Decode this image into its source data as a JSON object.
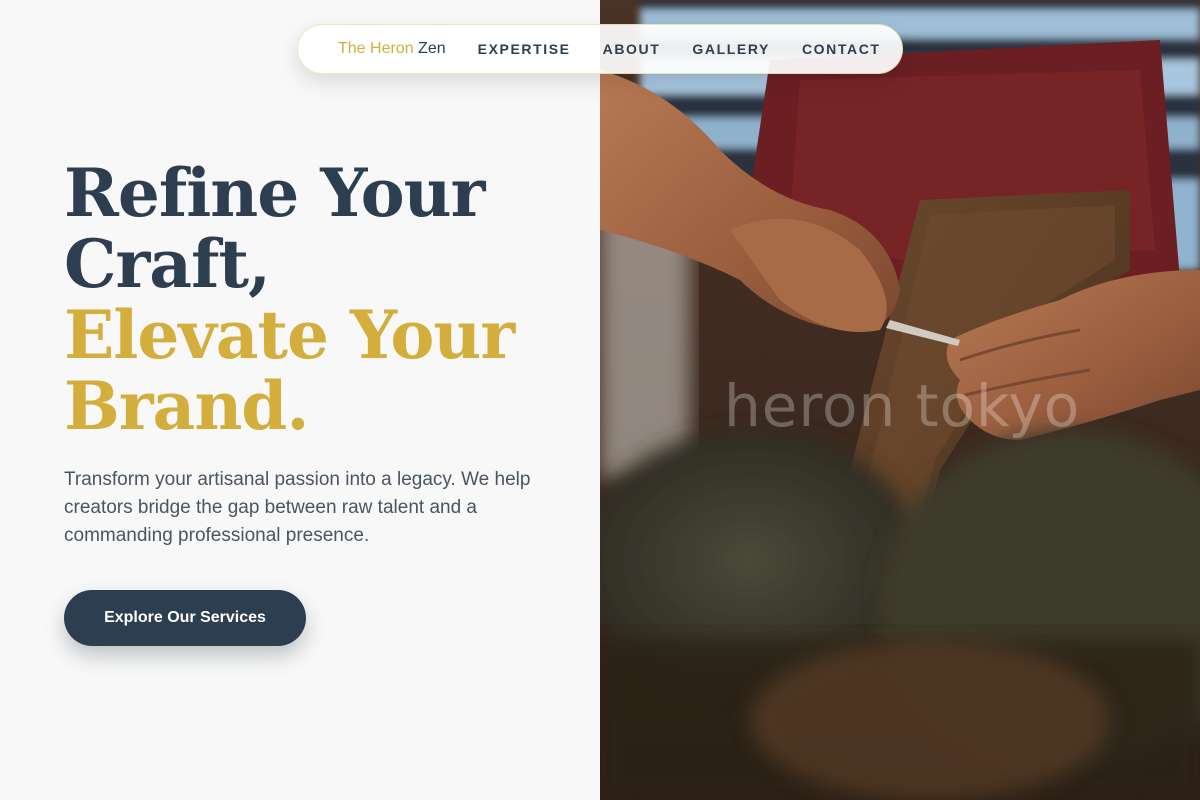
{
  "nav": {
    "brand_prefix": "The Heron",
    "brand_suffix": "Zen",
    "links": [
      "EXPERTISE",
      "ABOUT",
      "GALLERY",
      "CONTACT"
    ]
  },
  "hero": {
    "title_line1": "Refine Your",
    "title_line2": "Craft,",
    "title_line3": "Elevate Your",
    "title_line4": "Brand.",
    "description": "Transform your artisanal passion into a legacy. We help creators bridge the gap between raw talent and a commanding professional presence.",
    "cta_label": "Explore Our Services"
  },
  "photo": {
    "watermark": "heron tokyo"
  },
  "colors": {
    "navy": "#2c3e50",
    "gold": "#d4ae3c",
    "background": "#f8f8f8",
    "body_text": "#4a5562"
  }
}
